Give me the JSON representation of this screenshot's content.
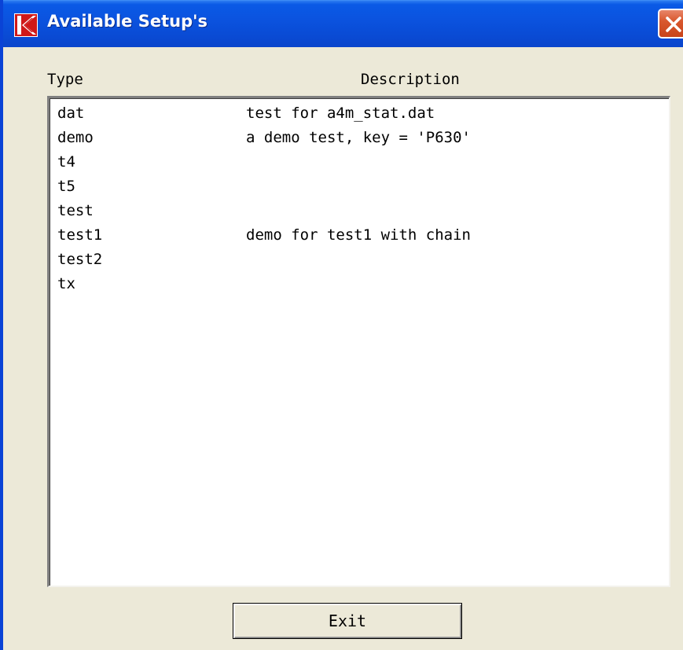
{
  "window": {
    "title": "Available Setup's",
    "app_icon": "k-logo-icon",
    "close_icon": "close-icon",
    "accent_color": "#0a4cd6",
    "close_color": "#d9582e"
  },
  "columns": {
    "type_header": "Type",
    "description_header": "Description"
  },
  "setups": [
    {
      "type": "dat",
      "description": "test for a4m_stat.dat"
    },
    {
      "type": "demo",
      "description": "a demo test, key = 'P630'"
    },
    {
      "type": "t4",
      "description": ""
    },
    {
      "type": "t5",
      "description": ""
    },
    {
      "type": "test",
      "description": ""
    },
    {
      "type": "test1",
      "description": "demo for test1 with chain"
    },
    {
      "type": "test2",
      "description": ""
    },
    {
      "type": "tx",
      "description": ""
    }
  ],
  "buttons": {
    "exit_label": "Exit"
  }
}
